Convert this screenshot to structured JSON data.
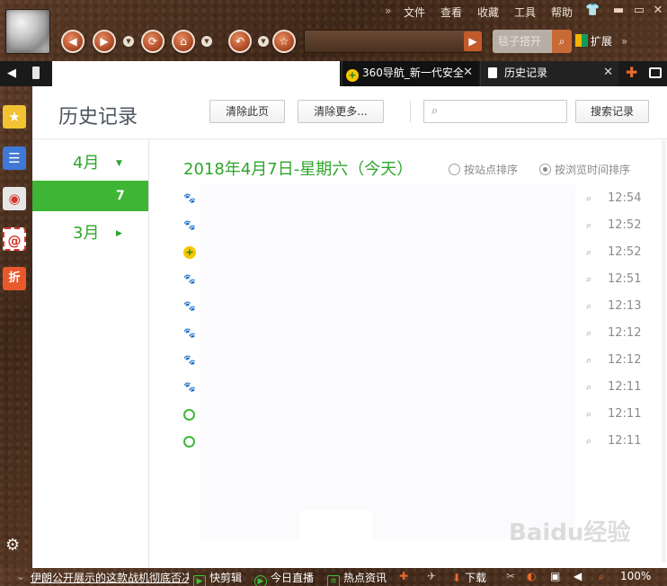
{
  "menu": [
    "文件",
    "查看",
    "收藏",
    "工具",
    "帮助"
  ],
  "toolbar": {
    "search_placeholder": "毯子搭开",
    "extensions_label": "扩展"
  },
  "tabs": [
    {
      "title": "360导航_新一代安全",
      "icon": "360-icon"
    },
    {
      "title": "历史记录",
      "icon": "page-icon",
      "active": true
    }
  ],
  "history": {
    "page_title": "历史记录",
    "clear_page_label": "清除此页",
    "clear_more_label": "清除更多...",
    "search_button_label": "搜索记录",
    "search_placeholder": "",
    "months": [
      {
        "label": "4月",
        "expanded": true
      },
      {
        "label": "3月",
        "expanded": false
      }
    ],
    "selected_day": "7",
    "date_heading": "2018年4月7日-星期六（今天）",
    "sort_by_site_label": "按站点排序",
    "sort_by_time_label": "按浏览时间排序",
    "sort_selected": "time",
    "entries": [
      {
        "icon": "baidu-paw-icon",
        "title": "",
        "time": "12:54"
      },
      {
        "icon": "baidu-paw-icon",
        "title": "",
        "time": "12:52"
      },
      {
        "icon": "360-icon",
        "title": "",
        "time": "12:52"
      },
      {
        "icon": "baidu-paw-icon",
        "title": "",
        "time": "12:51"
      },
      {
        "icon": "baidu-paw-icon",
        "title": "",
        "time": "12:13"
      },
      {
        "icon": "baidu-paw-icon",
        "title": "",
        "time": "12:12"
      },
      {
        "icon": "baidu-paw-icon",
        "title": "",
        "time": "12:12"
      },
      {
        "icon": "baidu-paw-icon",
        "title": "",
        "time": "12:11"
      },
      {
        "icon": "green-ring-icon",
        "title": "",
        "time": "12:11"
      },
      {
        "icon": "green-ring-icon",
        "title": "",
        "time": "12:11"
      }
    ]
  },
  "statusbar": {
    "news": "伊朗公开展示的这款战机彻底否决",
    "quick_clip": "快剪辑",
    "live_today": "今日直播",
    "hot_news": "热点资讯",
    "download": "下载",
    "zoom": "100%"
  },
  "watermark": "Baidu经验",
  "colors": {
    "accent_green": "#3eb534",
    "toolbar_leather": "#4b2f1e",
    "nav_orange": "#b9532d"
  }
}
